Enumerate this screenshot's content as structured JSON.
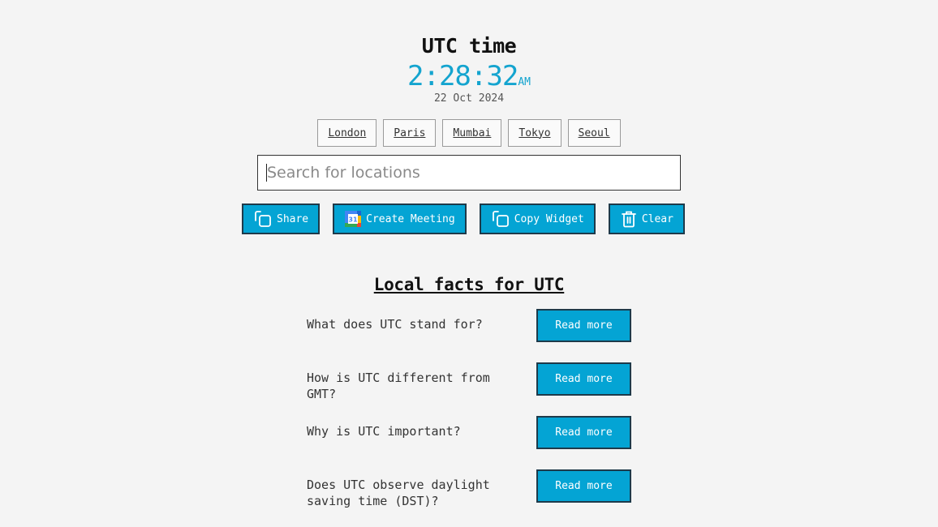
{
  "header": {
    "title": "UTC time",
    "time": "2:28:32",
    "ampm": "AM",
    "date": "22 Oct 2024"
  },
  "cities": [
    "London",
    "Paris",
    "Mumbai",
    "Tokyo",
    "Seoul"
  ],
  "search": {
    "placeholder": "Search for locations",
    "value": ""
  },
  "actions": {
    "share": "Share",
    "create_meeting": "Create Meeting",
    "copy_widget": "Copy Widget",
    "clear": "Clear"
  },
  "facts": {
    "title": "Local facts for UTC",
    "items": [
      {
        "question": "What does UTC stand for?",
        "button": "Read more"
      },
      {
        "question": "How is UTC different from GMT?",
        "button": "Read more"
      },
      {
        "question": "Why is UTC important?",
        "button": "Read more"
      },
      {
        "question": "Does UTC observe daylight saving time (DST)?",
        "button": "Read more"
      }
    ]
  },
  "colors": {
    "accent": "#04a4d4",
    "clock": "#14a4cf",
    "button_border": "#1e3a4a",
    "background": "#f4f4f4"
  }
}
